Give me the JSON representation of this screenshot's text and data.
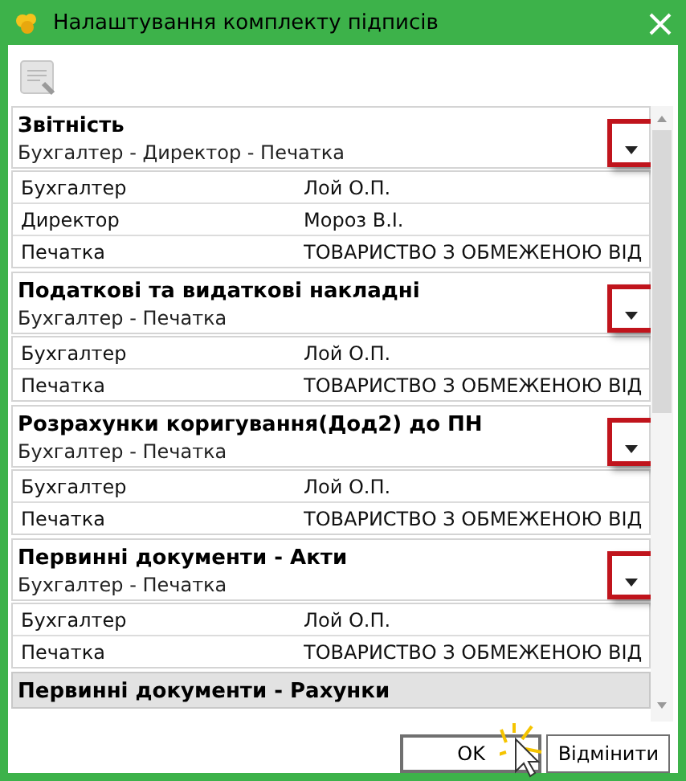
{
  "window": {
    "title": "Налаштування комплекту підписів"
  },
  "groups": [
    {
      "title": "Звітність",
      "subtitle": "Бухгалтер - Директор - Печатка",
      "selected": false,
      "dropdown_highlighted": true,
      "rows": [
        {
          "role": "Бухгалтер",
          "value": "Лой О.П."
        },
        {
          "role": "Директор",
          "value": "Мороз В.І."
        },
        {
          "role": "Печатка",
          "value": "ТОВАРИСТВО З ОБМЕЖЕНОЮ ВІД"
        }
      ]
    },
    {
      "title": "Податкові та видаткові накладні",
      "subtitle": "Бухгалтер - Печатка",
      "selected": false,
      "dropdown_highlighted": true,
      "rows": [
        {
          "role": "Бухгалтер",
          "value": "Лой О.П."
        },
        {
          "role": "Печатка",
          "value": "ТОВАРИСТВО З ОБМЕЖЕНОЮ ВІД"
        }
      ]
    },
    {
      "title": "Розрахунки коригування(Дод2) до ПН",
      "subtitle": "Бухгалтер - Печатка",
      "selected": false,
      "dropdown_highlighted": true,
      "rows": [
        {
          "role": "Бухгалтер",
          "value": "Лой О.П."
        },
        {
          "role": "Печатка",
          "value": "ТОВАРИСТВО З ОБМЕЖЕНОЮ ВІД"
        }
      ]
    },
    {
      "title": "Первинні документи - Акти",
      "subtitle": "Бухгалтер - Печатка",
      "selected": false,
      "dropdown_highlighted": true,
      "rows": [
        {
          "role": "Бухгалтер",
          "value": "Лой О.П."
        },
        {
          "role": "Печатка",
          "value": "ТОВАРИСТВО З ОБМЕЖЕНОЮ ВІД"
        }
      ]
    },
    {
      "title": "Первинні документи - Рахунки",
      "selected": true
    }
  ],
  "buttons": [
    {
      "label": "OK",
      "kind": "default"
    },
    {
      "label": "Відмінити",
      "kind": "normal"
    }
  ]
}
